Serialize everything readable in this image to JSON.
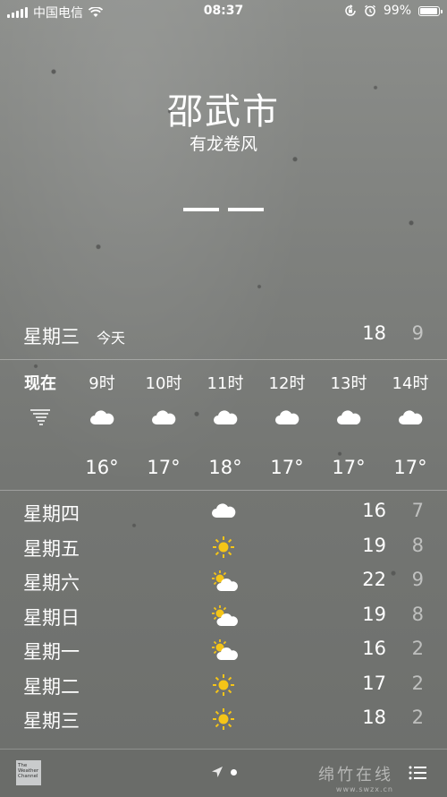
{
  "status_bar": {
    "carrier": "中国电信",
    "time": "08:37",
    "battery_percent": "99%",
    "battery_level": 0.99,
    "icons": [
      "signal-icon",
      "wifi-icon",
      "orientation-lock-icon",
      "alarm-icon",
      "battery-icon"
    ]
  },
  "header": {
    "city": "邵武市",
    "condition": "有龙卷风",
    "current_temp_placeholder": "— —"
  },
  "today": {
    "day": "星期三",
    "tag": "今天",
    "high": "18",
    "low": "9"
  },
  "hourly": [
    {
      "label": "现在",
      "icon": "tornado-icon",
      "temp": ""
    },
    {
      "label": "9时",
      "icon": "cloud-icon",
      "temp": "16°"
    },
    {
      "label": "10时",
      "icon": "cloud-icon",
      "temp": "17°"
    },
    {
      "label": "11时",
      "icon": "cloud-icon",
      "temp": "18°"
    },
    {
      "label": "12时",
      "icon": "cloud-icon",
      "temp": "17°"
    },
    {
      "label": "13时",
      "icon": "cloud-icon",
      "temp": "17°"
    },
    {
      "label": "14时",
      "icon": "cloud-icon",
      "temp": "17°"
    }
  ],
  "daily": [
    {
      "day": "星期四",
      "icon": "cloud-icon",
      "high": "16",
      "low": "7"
    },
    {
      "day": "星期五",
      "icon": "sun-icon",
      "high": "19",
      "low": "8"
    },
    {
      "day": "星期六",
      "icon": "partly-cloudy-icon",
      "high": "22",
      "low": "9"
    },
    {
      "day": "星期日",
      "icon": "partly-cloudy-icon",
      "high": "19",
      "low": "8"
    },
    {
      "day": "星期一",
      "icon": "partly-cloudy-icon",
      "high": "16",
      "low": "2"
    },
    {
      "day": "星期二",
      "icon": "sun-icon",
      "high": "17",
      "low": "2"
    },
    {
      "day": "星期三",
      "icon": "sun-icon",
      "high": "18",
      "low": "2"
    }
  ],
  "bottom_bar": {
    "logo_text": "The Weather Channel",
    "watermark": "绵竹在线",
    "watermark_url": "www.swzx.cn"
  },
  "colors": {
    "background": "#7f817e",
    "text": "#ffffff",
    "low_temp": "rgba(255,255,255,0.55)",
    "sun": "#f5c518"
  }
}
